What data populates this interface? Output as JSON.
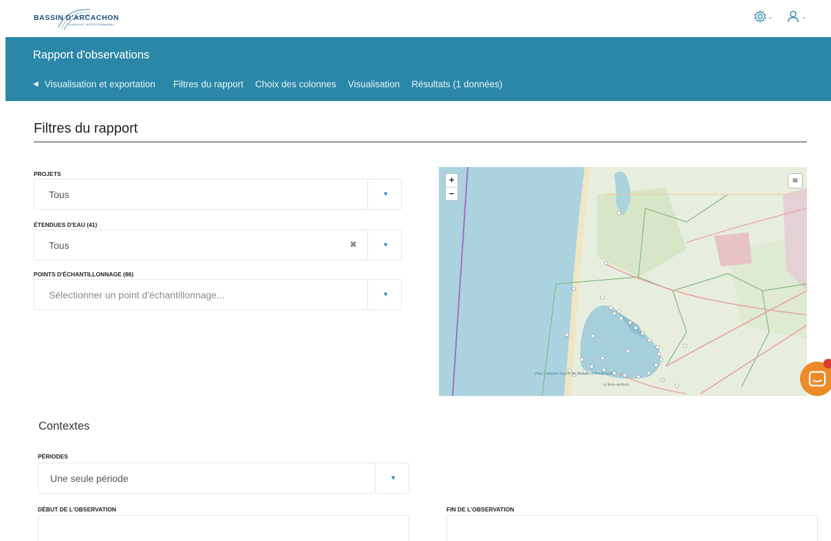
{
  "brand": {
    "logo_text": "BASSIN D'ARCACHON",
    "logo_sub": "SYNDICAT INTERCOMMUNAL"
  },
  "header_icons": [
    "settings-gear-icon",
    "user-icon"
  ],
  "band": {
    "title": "Rapport d'observations",
    "back_label": "Visualisation et exportation",
    "nav": [
      "Filtres du rapport",
      "Choix des colonnes",
      "Visualisation",
      "Résultats (1 données)"
    ]
  },
  "section": {
    "title": "Filtres du rapport"
  },
  "filters": {
    "projets": {
      "label": "PROJETS",
      "value": "Tous"
    },
    "etendues": {
      "label": "ÉTENDUES D'EAU (41)",
      "value": "Tous"
    },
    "points": {
      "label": "POINTS D'ÉCHANTILLONNAGE (86)",
      "placeholder": "Sélectionner un point d'échantillonnage..."
    }
  },
  "map": {
    "zoom_in": "+",
    "zoom_out": "−",
    "park_label": "Parc naturel marin du Bassin d'Arcachon",
    "town_label": "La Teste-de-Buch"
  },
  "contextes": {
    "title": "Contextes",
    "periodes": {
      "label": "PÉRIODES",
      "value": "Une seule période"
    },
    "debut_label": "DÉBUT DE L'OBSERVATION",
    "fin_label": "FIN DE L'OBSERVATION"
  },
  "colors": {
    "band": "#2b87a8",
    "accent": "#2b86a7",
    "chat": "#ec8a2a"
  }
}
